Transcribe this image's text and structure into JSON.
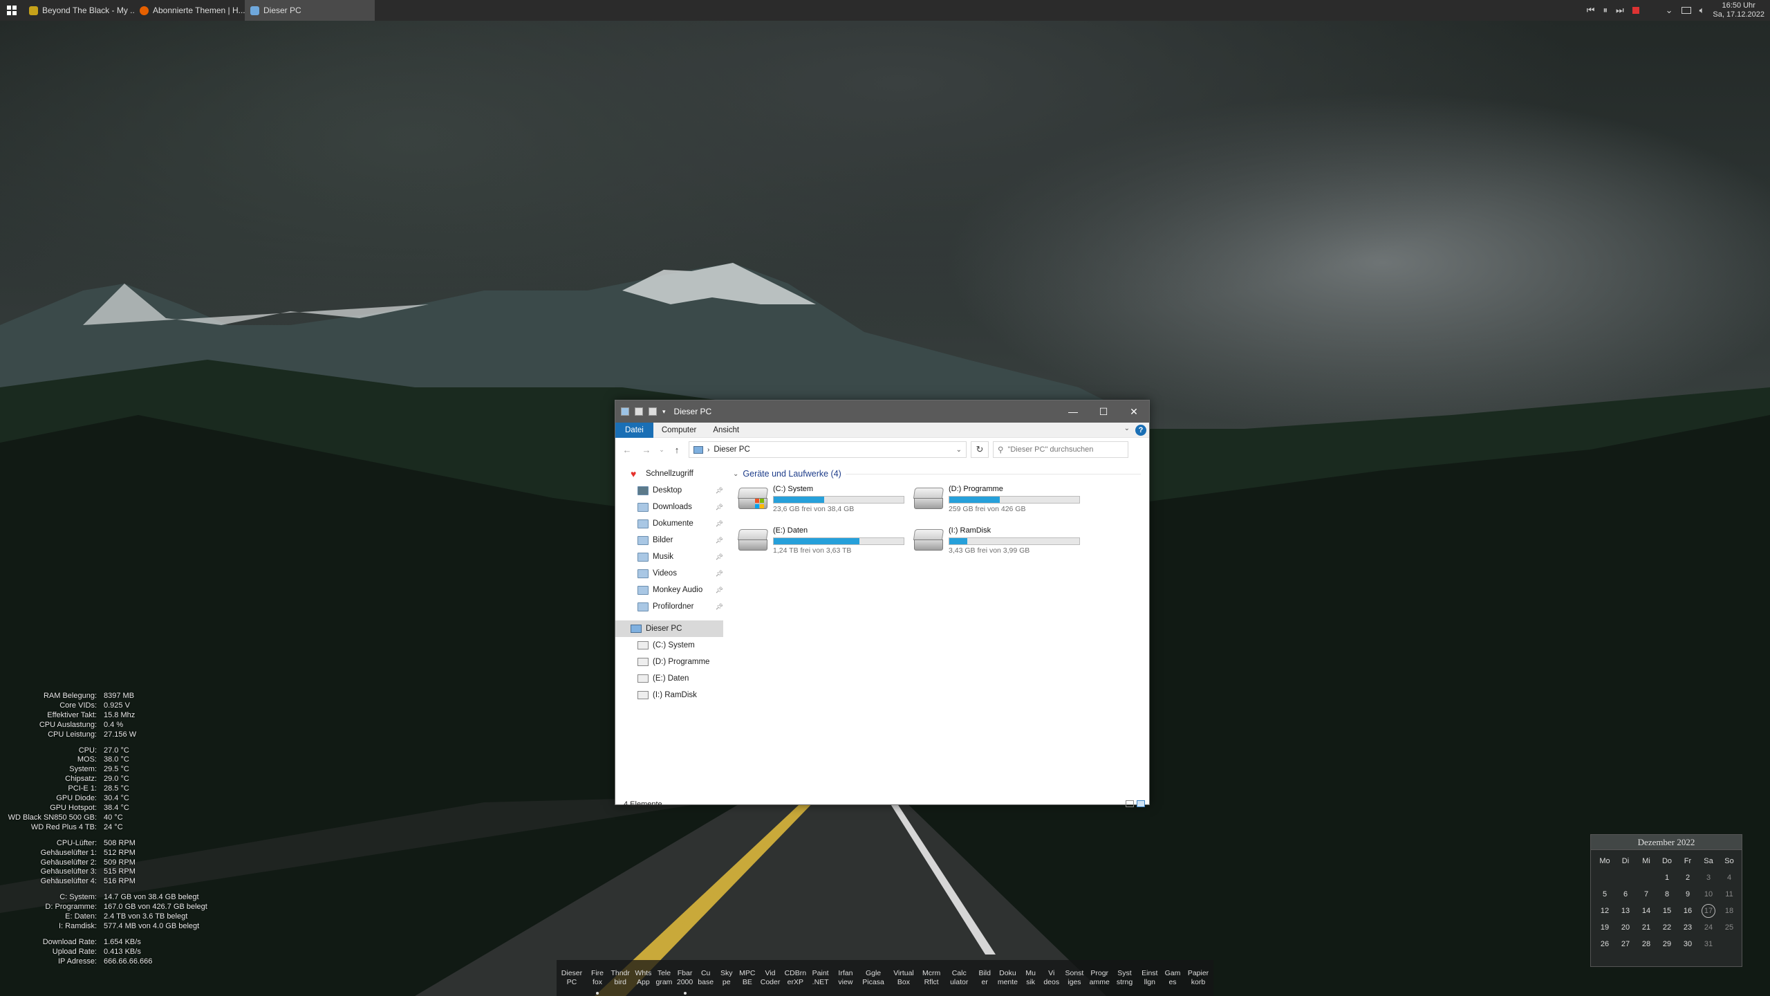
{
  "taskbar": {
    "tabs": [
      {
        "label": "Beyond The Black - My ...",
        "icon": "music-icon",
        "color": "#c7a21a"
      },
      {
        "label": "Abonnierte Themen | H...",
        "icon": "firefox-icon",
        "color": "#e66000"
      },
      {
        "label": "Dieser PC",
        "icon": "computer-icon",
        "color": "#6fa8dc"
      }
    ],
    "tray": {
      "prev": "⏮",
      "pause": "⏸",
      "next": "⏭",
      "time": "16:50 Uhr",
      "date": "Sa, 17.12.2022"
    }
  },
  "explorer": {
    "title": "Dieser PC",
    "ribbon_tabs": [
      "Datei",
      "Computer",
      "Ansicht"
    ],
    "help": "?",
    "address": "Dieser PC",
    "search_placeholder": "\"Dieser PC\" durchsuchen",
    "nav": {
      "quick_access": "Schnellzugriff",
      "pinned": [
        "Desktop",
        "Downloads",
        "Dokumente",
        "Bilder",
        "Musik",
        "Videos",
        "Monkey Audio",
        "Profilordner"
      ],
      "this_pc": "Dieser PC",
      "drives": [
        "(C:) System",
        "(D:) Programme",
        "(E:) Daten",
        "(I:) RamDisk"
      ]
    },
    "group_header": "Geräte und Laufwerke (4)",
    "drives": [
      {
        "name": "(C:) System",
        "free": "23,6 GB frei von 38,4 GB",
        "used_fraction": 0.39,
        "system": true
      },
      {
        "name": "(D:) Programme",
        "free": "259 GB frei von 426 GB",
        "used_fraction": 0.39,
        "system": false
      },
      {
        "name": "(E:) Daten",
        "free": "1,24 TB frei von 3,63 TB",
        "used_fraction": 0.66,
        "system": false
      },
      {
        "name": "(I:) RamDisk",
        "free": "3,43 GB frei von 3,99 GB",
        "used_fraction": 0.14,
        "system": false
      }
    ],
    "status": "4 Elemente"
  },
  "stats": {
    "group1": [
      [
        "RAM Belegung:",
        "8397 MB"
      ],
      [
        "Core VIDs:",
        "0.925 V"
      ],
      [
        "Effektiver Takt:",
        "15.8 Mhz"
      ],
      [
        "CPU Auslastung:",
        "0.4 %"
      ],
      [
        "CPU Leistung:",
        "27.156 W"
      ]
    ],
    "group2": [
      [
        "CPU:",
        "27.0 °C"
      ],
      [
        "MOS:",
        "38.0 °C"
      ],
      [
        "System:",
        "29.5 °C"
      ],
      [
        "Chipsatz:",
        "29.0 °C"
      ],
      [
        "PCI-E 1:",
        "28.5 °C"
      ],
      [
        "GPU Diode:",
        "30.4 °C"
      ],
      [
        "GPU Hotspot:",
        "38.4 °C"
      ],
      [
        "WD Black SN850 500 GB:",
        "40 °C"
      ],
      [
        "WD Red Plus 4 TB:",
        "24 °C"
      ]
    ],
    "group3": [
      [
        "CPU-Lüfter:",
        "508 RPM"
      ],
      [
        "Gehäuselüfter 1:",
        "512 RPM"
      ],
      [
        "Gehäuselüfter 2:",
        "509 RPM"
      ],
      [
        "Gehäuselüfter 3:",
        "515 RPM"
      ],
      [
        "Gehäuselüfter 4:",
        "516 RPM"
      ]
    ],
    "group4": [
      [
        "C: System:",
        "14.7 GB von 38.4 GB belegt"
      ],
      [
        "D: Programme:",
        "167.0 GB von 426.7 GB belegt"
      ],
      [
        "E: Daten:",
        "2.4 TB von 3.6 TB belegt"
      ],
      [
        "I: Ramdisk:",
        "577.4 MB von 4.0 GB belegt"
      ]
    ],
    "group5": [
      [
        "Download Rate:",
        "1.654 KB/s"
      ],
      [
        "Upload Rate:",
        "0.413 KB/s"
      ],
      [
        "IP Adresse:",
        "666.66.66.666"
      ]
    ]
  },
  "calendar": {
    "title": "Dezember 2022",
    "weekdays": [
      "Mo",
      "Di",
      "Mi",
      "Do",
      "Fr",
      "Sa",
      "So"
    ],
    "leading_blanks": 3,
    "days": 31,
    "today": 17
  },
  "dock": [
    {
      "label": "Dieser\nPC",
      "running": false
    },
    {
      "label": "Fire\nfox",
      "running": true
    },
    {
      "label": "Thndr\nbird",
      "running": false
    },
    {
      "label": "Whts\nApp",
      "running": false
    },
    {
      "label": "Tele\ngram",
      "running": false
    },
    {
      "label": "Fbar\n2000",
      "running": true
    },
    {
      "label": "Cu\nbase",
      "running": false
    },
    {
      "label": "Sky\npe",
      "running": false
    },
    {
      "label": "MPC\nBE",
      "running": false
    },
    {
      "label": "Vid\nCoder",
      "running": false
    },
    {
      "label": "CDBrn\nerXP",
      "running": false
    },
    {
      "label": "Paint\n.NET",
      "running": false
    },
    {
      "label": "Irfan\nview",
      "running": false
    },
    {
      "label": "Ggle\nPicasa",
      "running": false
    },
    {
      "label": "Virtual\nBox",
      "running": false
    },
    {
      "label": "Mcrm\nRflct",
      "running": false
    },
    {
      "label": "Calc\nulator",
      "running": false
    },
    {
      "label": "Bild\ner",
      "running": false
    },
    {
      "label": "Doku\nmente",
      "running": false
    },
    {
      "label": "Mu\nsik",
      "running": false
    },
    {
      "label": "Vi\ndeos",
      "running": false
    },
    {
      "label": "Sonst\niges",
      "running": false
    },
    {
      "label": "Progr\namme",
      "running": false
    },
    {
      "label": "Syst\nstrng",
      "running": false
    },
    {
      "label": "Einst\nllgn",
      "running": false
    },
    {
      "label": "Gam\nes",
      "running": false
    },
    {
      "label": "Papier\nkorb",
      "running": false
    }
  ]
}
